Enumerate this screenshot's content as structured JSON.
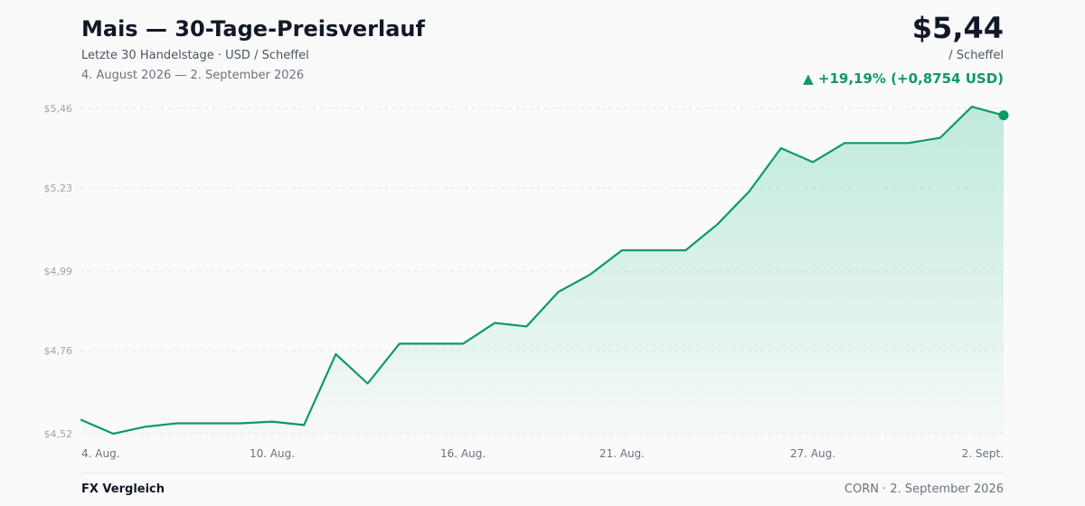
{
  "header": {
    "title": "Mais — 30-Tage-Preisverlauf",
    "subtitle": "Letzte 30 Handelstage · USD / Scheffel",
    "date_range": "4. August 2026 — 2. September 2026"
  },
  "quote": {
    "price": "$5,44",
    "unit": "/ Scheffel",
    "change": "▲ +19,19% (+0,8754 USD)"
  },
  "footer": {
    "brand": "FX Vergleich",
    "meta": "CORN · 2. September 2026"
  },
  "colors": {
    "line": "#0e9a63",
    "area": "#10b981",
    "grid": "#e5e7eb",
    "tick": "#9ca3af",
    "xtick": "#6b7280"
  },
  "chart_data": {
    "type": "area",
    "x_unit": "trading day",
    "y_unit": "USD / Scheffel",
    "ylim": [
      4.52,
      5.46
    ],
    "xlim": [
      0,
      29
    ],
    "y_ticks": [
      4.52,
      4.76,
      4.99,
      5.23,
      5.46
    ],
    "y_tick_labels": [
      "$4,52",
      "$4,76",
      "$4,99",
      "$5,23",
      "$5,46"
    ],
    "x_ticks": [
      {
        "day": 0,
        "label": "4. Aug."
      },
      {
        "day": 6,
        "label": "10. Aug."
      },
      {
        "day": 12,
        "label": "16. Aug."
      },
      {
        "day": 17,
        "label": "21. Aug."
      },
      {
        "day": 23,
        "label": "27. Aug."
      },
      {
        "day": 29,
        "label": "2. Sept."
      }
    ],
    "grid": true,
    "series": [
      {
        "values": [
          4.56,
          4.52,
          4.54,
          4.55,
          4.55,
          4.55,
          4.555,
          4.545,
          4.75,
          4.665,
          4.78,
          4.78,
          4.78,
          4.84,
          4.83,
          4.93,
          4.98,
          5.05,
          5.05,
          5.05,
          5.125,
          5.22,
          5.345,
          5.305,
          5.36,
          5.36,
          5.36,
          5.375,
          5.465,
          5.44
        ]
      }
    ]
  }
}
